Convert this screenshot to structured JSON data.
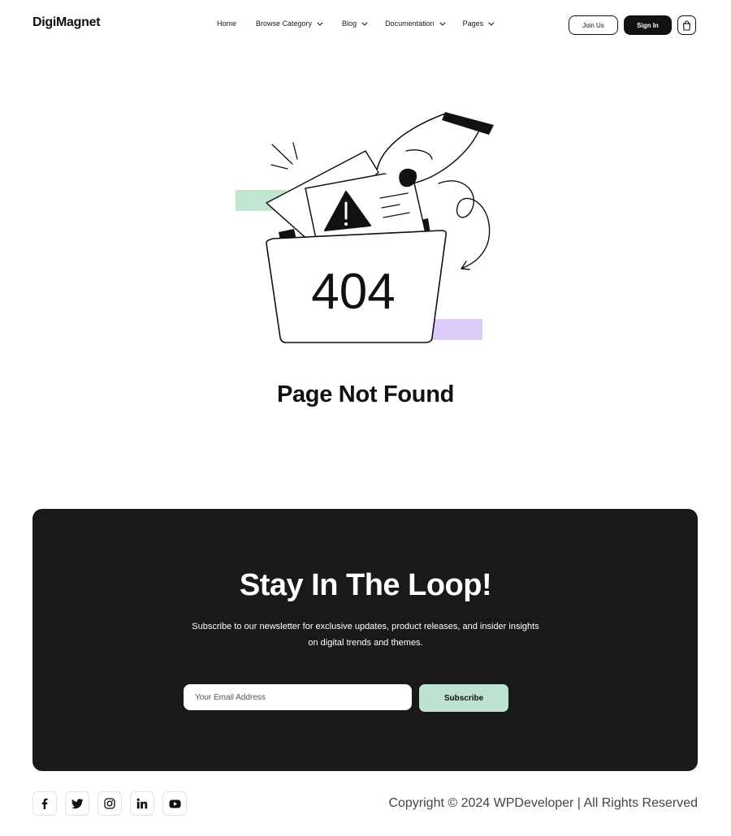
{
  "header": {
    "logo": "DigiMagnet",
    "nav": [
      {
        "label": "Home"
      },
      {
        "label": "Browse Category"
      },
      {
        "label": "Blog"
      },
      {
        "label": "Documentation"
      },
      {
        "label": "Pages"
      }
    ],
    "join_label": "Join Us",
    "signin_label": "Sign In"
  },
  "illustration": {
    "code": "404",
    "accent_green": "#c3e6d3",
    "accent_purple": "#dccbfb"
  },
  "main": {
    "title": "Page Not Found"
  },
  "newsletter": {
    "title": "Stay In The Loop!",
    "description": "Subscribe to our newsletter for exclusive updates, product releases, and insider insights on digital trends and themes.",
    "email_placeholder": "Your Email Address",
    "subscribe_label": "Subscribe",
    "background": "#191919",
    "button_color": "#bfe3d2"
  },
  "footer": {
    "socials": [
      "facebook-icon",
      "twitter-icon",
      "instagram-icon",
      "linkedin-icon",
      "youtube-icon"
    ],
    "copyright": "Copyright © 2024 WPDeveloper | All Rights Reserved"
  }
}
